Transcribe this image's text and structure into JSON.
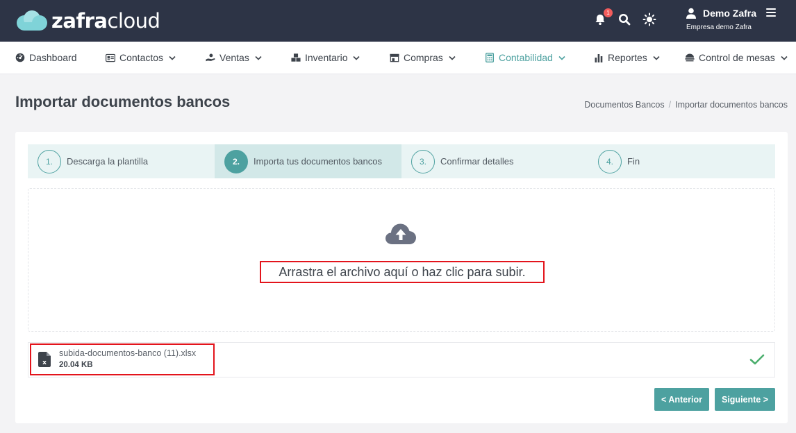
{
  "header": {
    "logo_bold": "zafra",
    "logo_light": "cloud",
    "notification_count": "1",
    "user_name": "Demo Zafra",
    "company": "Empresa demo Zafra"
  },
  "nav": {
    "items": [
      {
        "label": "Dashboard",
        "icon": "dashboard-icon",
        "has_menu": false
      },
      {
        "label": "Contactos",
        "icon": "id-card-icon",
        "has_menu": true
      },
      {
        "label": "Ventas",
        "icon": "hand-coin-icon",
        "has_menu": true
      },
      {
        "label": "Inventario",
        "icon": "boxes-icon",
        "has_menu": true
      },
      {
        "label": "Compras",
        "icon": "store-icon",
        "has_menu": true
      },
      {
        "label": "Contabilidad",
        "icon": "calculator-icon",
        "has_menu": true,
        "active": true
      },
      {
        "label": "Reportes",
        "icon": "bar-chart-icon",
        "has_menu": true
      },
      {
        "label": "Control de mesas",
        "icon": "food-tray-icon",
        "has_menu": true
      }
    ]
  },
  "page": {
    "title": "Importar documentos bancos",
    "breadcrumb": [
      "Documentos Bancos",
      "Importar documentos bancos"
    ]
  },
  "steps": [
    {
      "num": "1.",
      "label": "Descarga la plantilla"
    },
    {
      "num": "2.",
      "label": "Importa tus documentos bancos",
      "current": true
    },
    {
      "num": "3.",
      "label": "Confirmar detalles"
    },
    {
      "num": "4.",
      "label": "Fin"
    }
  ],
  "dropzone": {
    "text": "Arrastra el archivo aquí o haz clic para subir."
  },
  "file": {
    "name": "subida-documentos-banco (11).xlsx",
    "size": "20.04 KB"
  },
  "buttons": {
    "prev": "< Anterior",
    "next": "Siguiente >"
  },
  "colors": {
    "header_bg": "#2d3446",
    "accent": "#4da1a0",
    "highlight": "#e3141c",
    "success": "#4caf6e"
  }
}
